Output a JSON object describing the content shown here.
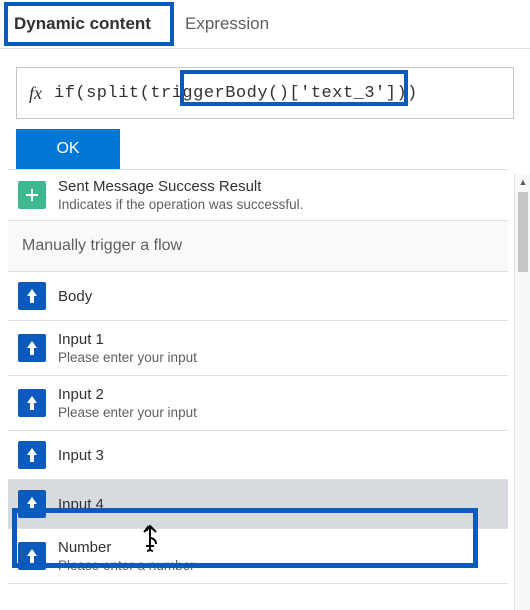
{
  "tabs": {
    "dynamic": "Dynamic content",
    "expression": "Expression"
  },
  "formula": {
    "fx": "fx",
    "text": "if(split(triggerBody()['text_3']))"
  },
  "ok_label": "OK",
  "sent": {
    "title": "Sent Message Success Result",
    "sub": "Indicates if the operation was successful."
  },
  "group": "Manually trigger a flow",
  "items": {
    "body": {
      "title": "Body"
    },
    "input1": {
      "title": "Input 1",
      "sub": "Please enter your input"
    },
    "input2": {
      "title": "Input 2",
      "sub": "Please enter your input"
    },
    "input3": {
      "title": "Input 3"
    },
    "input4": {
      "title": "Input 4"
    },
    "number": {
      "title": "Number",
      "sub": "Please enter a number"
    }
  }
}
